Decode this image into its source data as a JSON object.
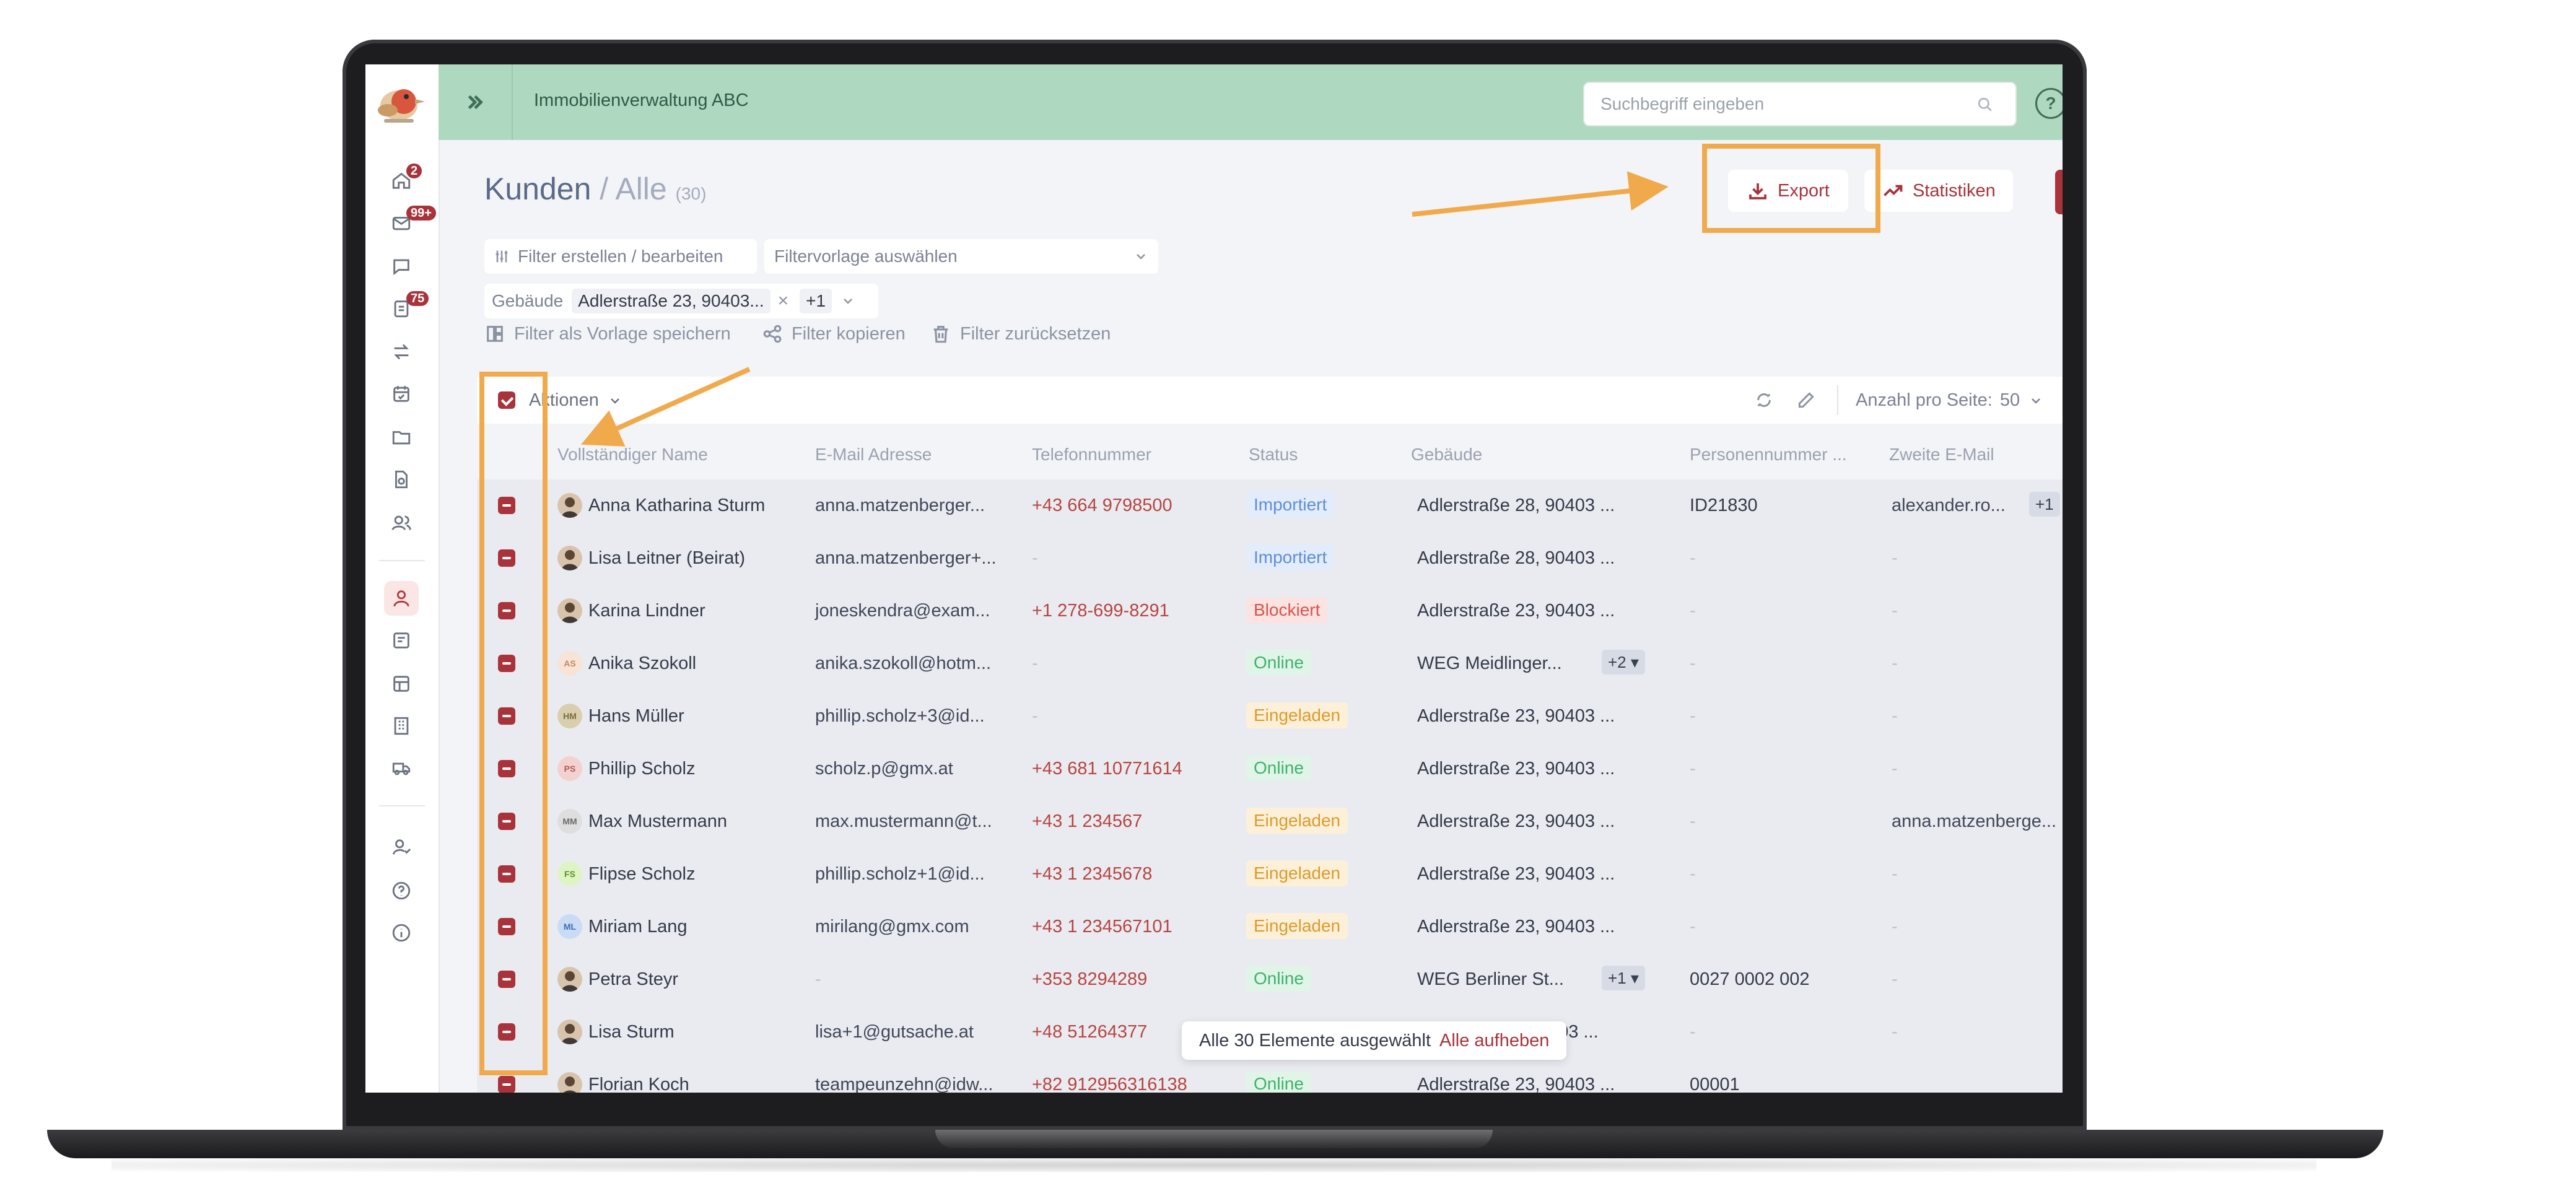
{
  "app": {
    "organization": "Immobilienverwaltung ABC",
    "search_placeholder": "Suchbegriff eingeben",
    "help_label": "?"
  },
  "nav": {
    "badges": {
      "home": "2",
      "mail": "99+",
      "tasks": "75"
    }
  },
  "page": {
    "title": "Kunden",
    "separator": "/",
    "subtitle": "Alle",
    "count": "(30)"
  },
  "actions": {
    "export_label": "Export",
    "stats_label": "Statistiken"
  },
  "filters": {
    "create_label": "Filter erstellen / bearbeiten",
    "template_placeholder": "Filtervorlage auswählen",
    "building_label": "Gebäude",
    "building_value": "Adlerstraße 23, 90403...",
    "building_more": "+1",
    "save_template": "Filter als Vorlage speichern",
    "copy": "Filter kopieren",
    "reset": "Filter zurücksetzen"
  },
  "toolbar": {
    "actions_label": "Aktionen",
    "per_page_label": "Anzahl pro Seite:",
    "per_page_value": "50"
  },
  "table": {
    "columns": [
      "Vollständiger Name",
      "E-Mail Adresse",
      "Telefonnummer",
      "Status",
      "Gebäude",
      "Personennummer ...",
      "Zweite E-Mail"
    ],
    "rows": [
      {
        "name": "Anna Katharina Sturm",
        "email": "anna.matzenberger...",
        "phone": "+43 664 9798500",
        "status": "Importiert",
        "building": "Adlerstraße 28, 90403 ...",
        "pnum": "ID21830",
        "email2": "alexander.ro...",
        "email2_more": "+1",
        "avatar": "photo",
        "initials": ""
      },
      {
        "name": "Lisa Leitner (Beirat)",
        "email": "anna.matzenberger+...",
        "phone": "-",
        "status": "Importiert",
        "building": "Adlerstraße 28, 90403 ...",
        "pnum": "-",
        "email2": "-",
        "avatar": "photo",
        "initials": ""
      },
      {
        "name": "Karina Lindner",
        "email": "joneskendra@exam...",
        "phone": "+1 278-699-8291",
        "status": "Blockiert",
        "building": "Adlerstraße 23, 90403 ...",
        "pnum": "-",
        "email2": "-",
        "avatar": "photo",
        "initials": ""
      },
      {
        "name": "Anika Szokoll",
        "email": "anika.szokoll@hotm...",
        "phone": "-",
        "status": "Online",
        "building": "WEG Meidlinger...",
        "building_more": "+2",
        "pnum": "-",
        "email2": "-",
        "avatar": "initials",
        "initials": "AS"
      },
      {
        "name": "Hans Müller",
        "email": "phillip.scholz+3@id...",
        "phone": "-",
        "status": "Eingeladen",
        "building": "Adlerstraße 23, 90403 ...",
        "pnum": "-",
        "email2": "-",
        "avatar": "initials",
        "initials": "HM"
      },
      {
        "name": "Phillip Scholz",
        "email": "scholz.p@gmx.at",
        "phone": "+43 681 10771614",
        "status": "Online",
        "building": "Adlerstraße 23, 90403 ...",
        "pnum": "-",
        "email2": "-",
        "avatar": "initials",
        "initials": "PS"
      },
      {
        "name": "Max Mustermann",
        "email": "max.mustermann@t...",
        "phone": "+43 1 234567",
        "status": "Eingeladen",
        "building": "Adlerstraße 23, 90403 ...",
        "pnum": "-",
        "email2": "anna.matzenberge...",
        "avatar": "initials",
        "initials": "MM"
      },
      {
        "name": "Flipse Scholz",
        "email": "phillip.scholz+1@id...",
        "phone": "+43 1 2345678",
        "status": "Eingeladen",
        "building": "Adlerstraße 23, 90403 ...",
        "pnum": "-",
        "email2": "-",
        "avatar": "initials",
        "initials": "FS"
      },
      {
        "name": "Miriam Lang",
        "email": "mirilang@gmx.com",
        "phone": "+43 1 234567101",
        "status": "Eingeladen",
        "building": "Adlerstraße 23, 90403 ...",
        "pnum": "-",
        "email2": "-",
        "avatar": "initials",
        "initials": "ML"
      },
      {
        "name": "Petra Steyr",
        "email": "-",
        "phone": "+353 8294289",
        "status": "Online",
        "building": "WEG Berliner St...",
        "building_more": "+1",
        "pnum": "0027 0002 002",
        "email2": "-",
        "avatar": "photo",
        "initials": ""
      },
      {
        "name": "Lisa Sturm",
        "email": "lisa+1@gutsache.at",
        "phone": "+48 51264377",
        "status": "",
        "building": "...03 ...",
        "pnum": "-",
        "email2": "-",
        "avatar": "photo",
        "initials": ""
      },
      {
        "name": "Florian Koch",
        "email": "teampeunzehn@idw...",
        "phone": "+82 912956316138",
        "status": "Online",
        "building": "Adlerstraße 23, 90403 ...",
        "pnum": "00001",
        "email2": "",
        "avatar": "photo",
        "initials": ""
      }
    ]
  },
  "toast": {
    "text": "Alle 30 Elemente ausgewählt",
    "action": "Alle aufheben"
  },
  "colors": {
    "accent": "#a8333a",
    "topbar": "#aed8c0",
    "annotation": "#f0aa4c"
  }
}
